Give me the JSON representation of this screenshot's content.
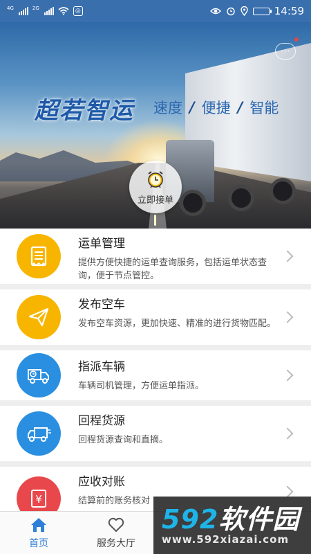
{
  "status_bar": {
    "signal_1_tag": "4G",
    "signal_2_tag": "2G",
    "app_notify_glyph": "◎",
    "time": "14:59",
    "battery_level": 0.55,
    "icons": [
      "signal-icon",
      "signal-icon",
      "wifi-icon",
      "app-notify-icon",
      "eye-icon",
      "alarm-icon",
      "location-icon",
      "battery-icon"
    ]
  },
  "banner": {
    "brand": "超若智运",
    "slogan": [
      "速度",
      "便捷",
      "智能"
    ],
    "slogan_separator": "/",
    "grab_label": "立即接单",
    "chat_glyph": "···"
  },
  "menu": [
    {
      "title": "运单管理",
      "desc": "提供方便快捷的运单查询服务，包括运单状态查询，便于节点管控。",
      "icon": "waybill-icon",
      "color": "#f7b500"
    },
    {
      "title": "发布空车",
      "desc": "发布空车资源，更加快速、精准的进行货物匹配。",
      "icon": "paper-plane-icon",
      "color": "#f7b500"
    },
    {
      "title": "指派车辆",
      "desc": "车辆司机管理，方便运单指派。",
      "icon": "truck-clock-icon",
      "color": "#2a8fe0"
    },
    {
      "title": "回程货源",
      "desc": "回程货源查询和直摘。",
      "icon": "return-truck-icon",
      "color": "#2a8fe0"
    },
    {
      "title": "应收对账",
      "desc": "结算前的账务核对",
      "icon": "yuan-receipt-icon",
      "color": "#e8484c"
    }
  ],
  "tabs": [
    {
      "label": "首页",
      "icon": "home-icon",
      "active": true
    },
    {
      "label": "服务大厅",
      "icon": "heart-icon",
      "active": false
    },
    {
      "label": "",
      "icon": "",
      "active": false
    }
  ],
  "watermark": {
    "number": "592",
    "text": "软件园",
    "url": "www.592xiazai.com"
  },
  "colors": {
    "status_bar": "#3a6fae",
    "accent": "#2f7fd8",
    "yellow": "#f7b500",
    "blue": "#2a8fe0",
    "red": "#e8484c"
  }
}
